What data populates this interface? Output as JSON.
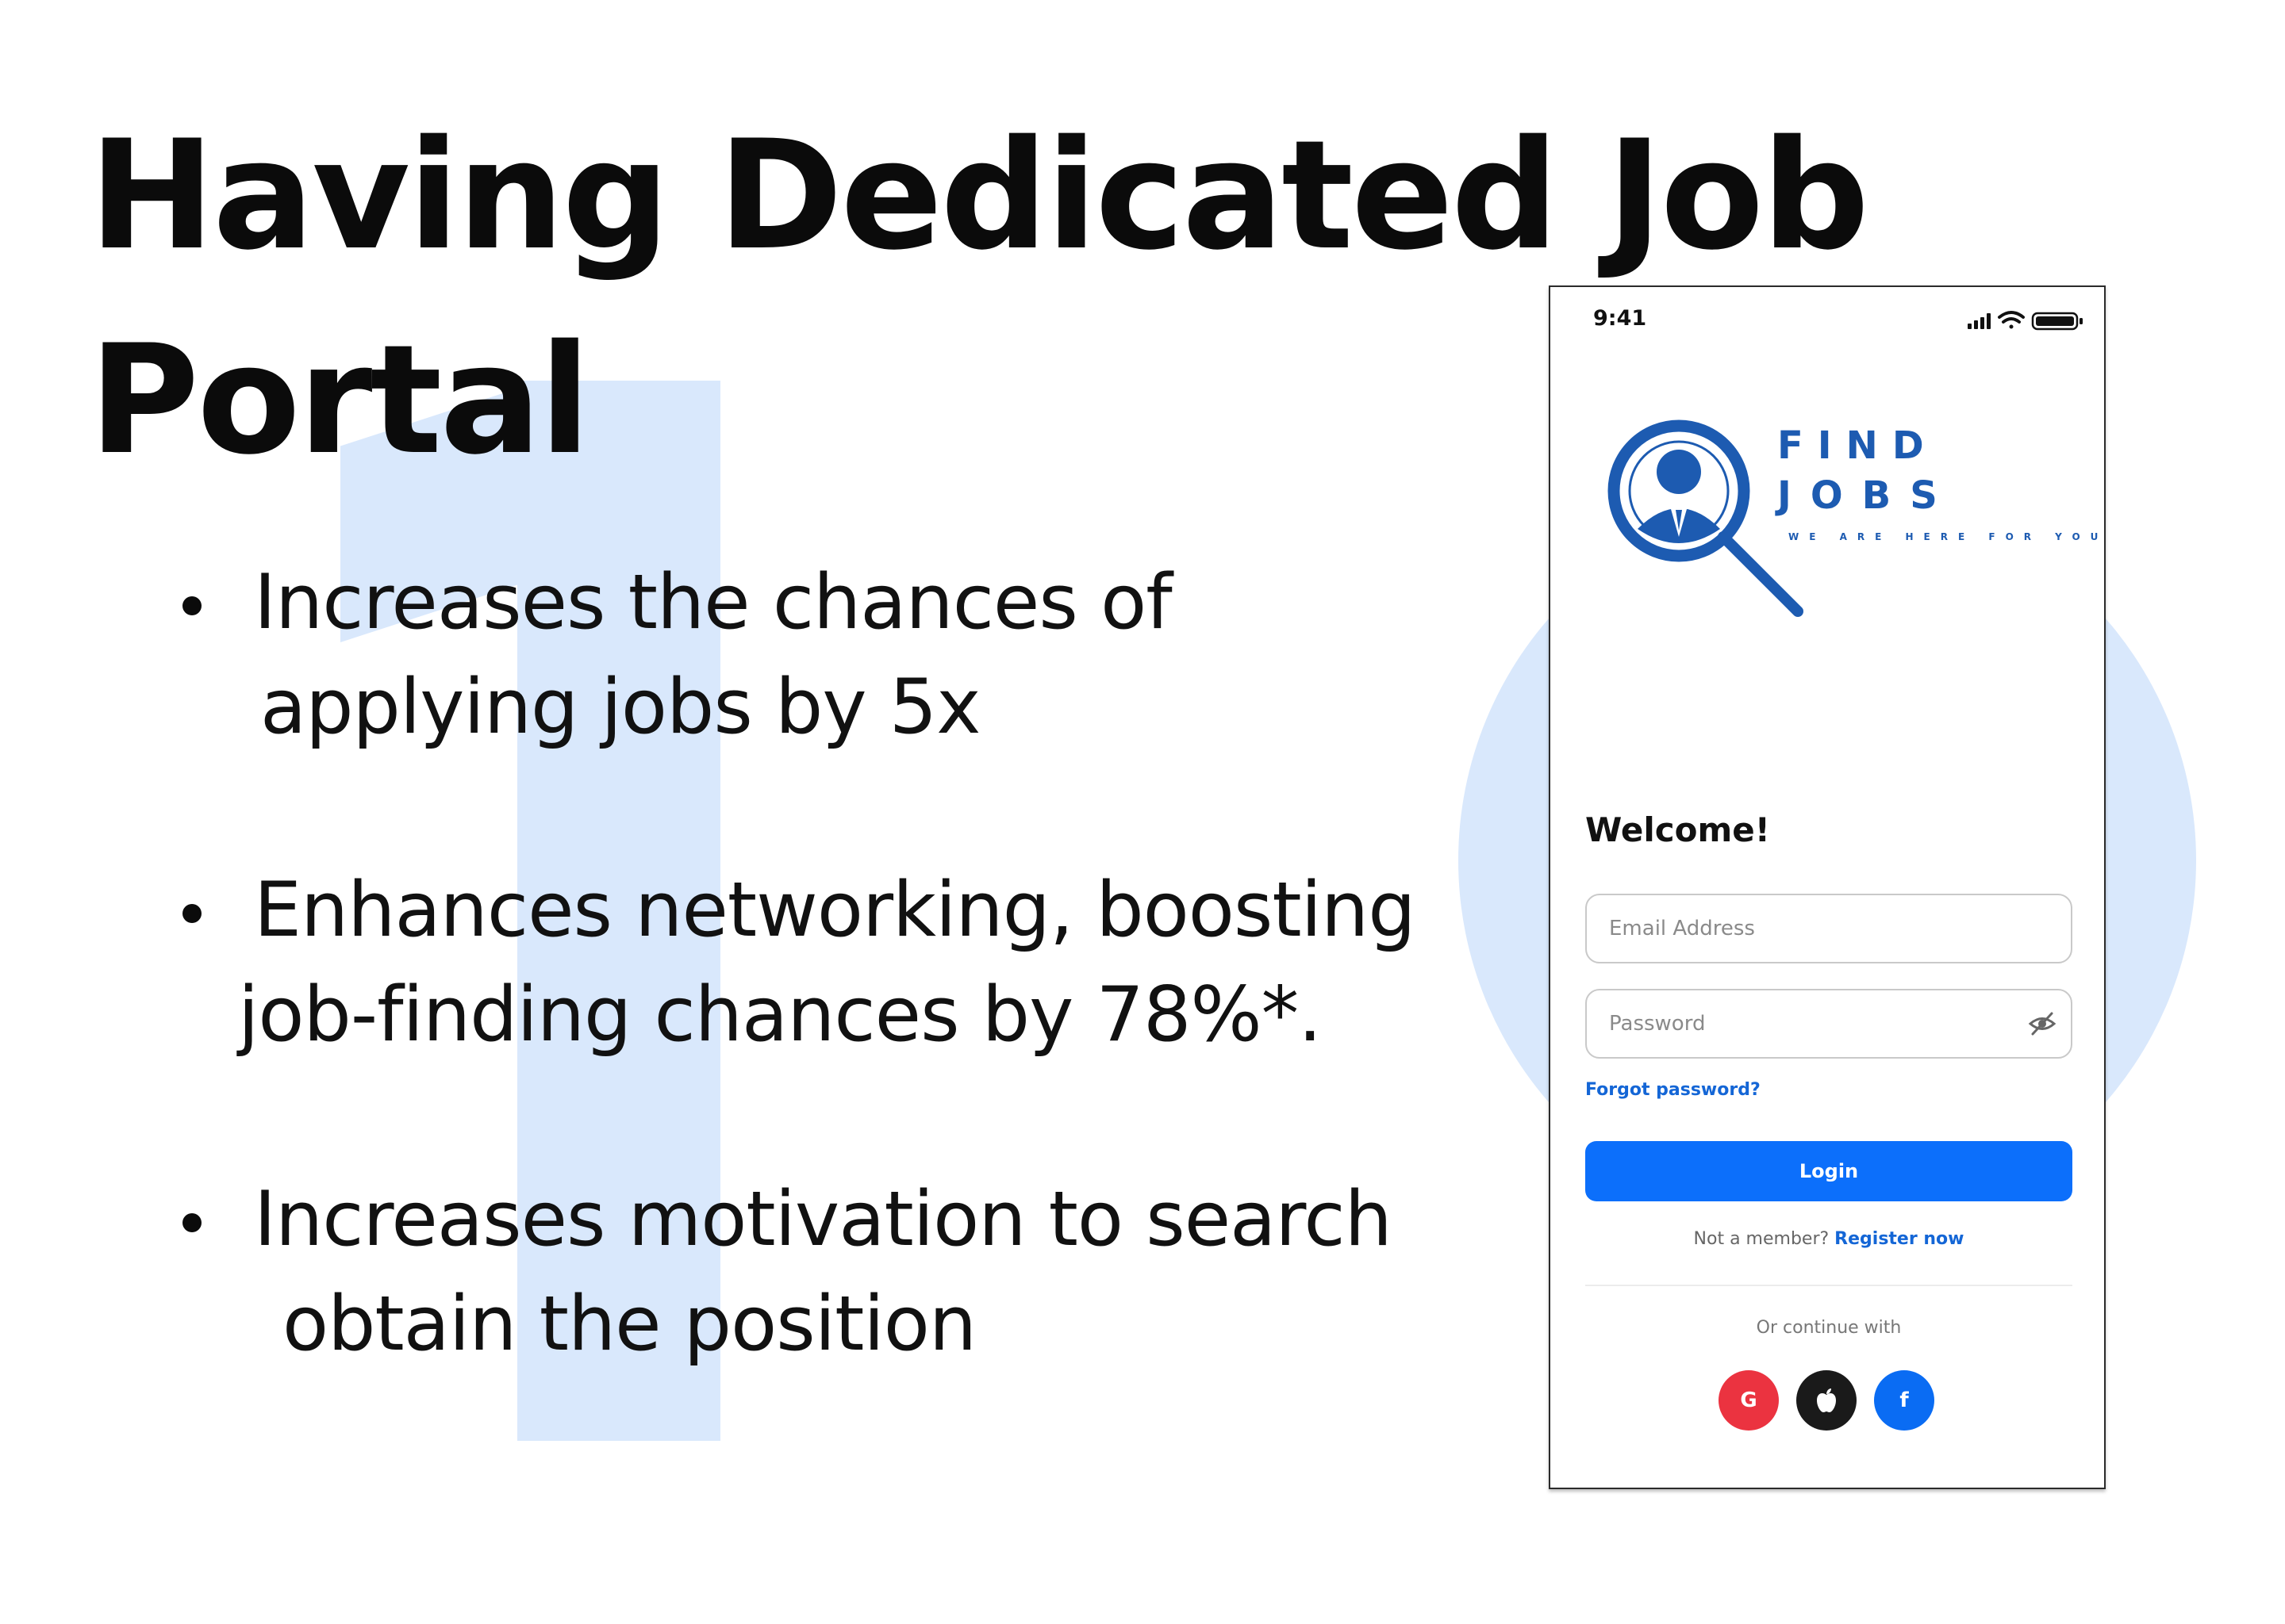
{
  "slide": {
    "title_line1": "Having Dedicated Job",
    "title_line2": "Portal",
    "bullets": [
      {
        "line1": "Increases the chances of",
        "line2": "applying jobs by 5x"
      },
      {
        "line1": "Enhances networking, boosting",
        "line2": "job-finding chances by 78%*."
      },
      {
        "line1": "Increases motivation to search",
        "line2": "obtain the position"
      }
    ]
  },
  "phone": {
    "status_time": "9:41",
    "status_icons": [
      "signal-icon",
      "wifi-icon",
      "battery-icon"
    ],
    "brand": {
      "line1": "FIND",
      "line2": "JOBS",
      "tagline": "WE ARE HERE FOR YOU",
      "color": "#1d5bb1"
    },
    "welcome": "Welcome!",
    "email_placeholder": "Email Address",
    "password_placeholder": "Password",
    "forgot_password": "Forgot password?",
    "login_label": "Login",
    "register_prompt": "Not a member?",
    "register_link": "Register now",
    "continue_with": "Or continue with",
    "social": [
      {
        "name": "google",
        "glyph": "G",
        "color": "#eb3340"
      },
      {
        "name": "apple",
        "glyph": "",
        "color": "#1a1a1a"
      },
      {
        "name": "facebook",
        "glyph": "f",
        "color": "#0a6cf3"
      }
    ],
    "accent_color": "#0c6ffb"
  },
  "colors": {
    "background_accent": "#d9e8fc",
    "text": "#0b0b0b"
  }
}
